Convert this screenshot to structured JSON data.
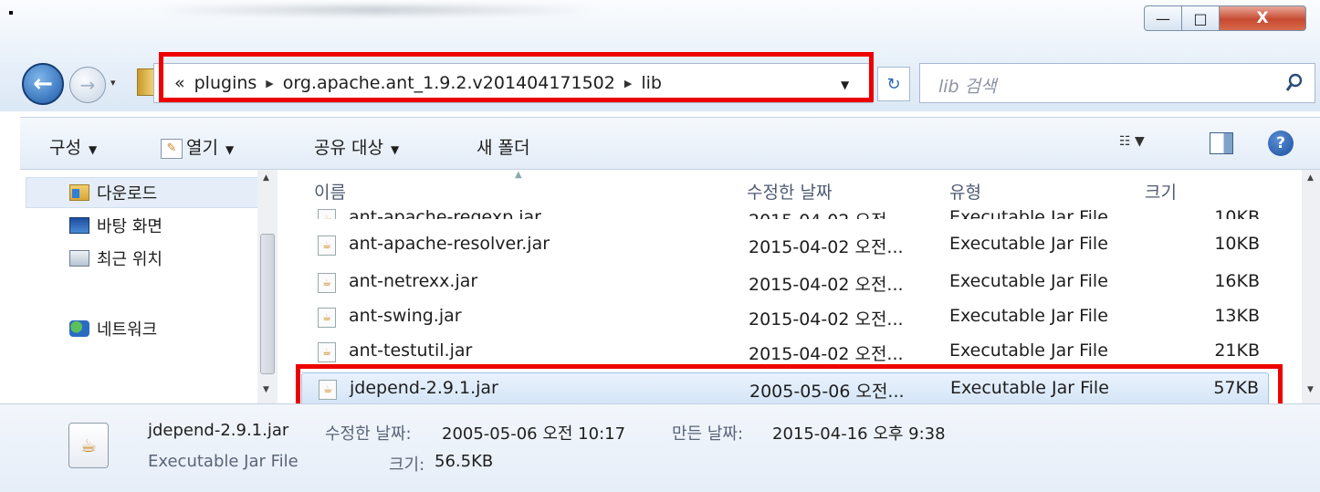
{
  "window": {
    "controls": {
      "minimize": "—",
      "maximize": "□",
      "close": "X"
    }
  },
  "nav": {
    "back_icon": "back-arrow-icon",
    "forward_icon": "forward-arrow-icon",
    "history_dropdown": "▾",
    "address": {
      "overflow": "«",
      "crumbs": [
        "plugins",
        "org.apache.ant_1.9.2.v201404171502",
        "lib"
      ],
      "separator": "▶",
      "dropdown": "▼"
    },
    "refresh_icon": "↻",
    "search": {
      "placeholder": "lib 검색",
      "icon": "magnifier-icon"
    }
  },
  "toolbar": {
    "organize": "구성",
    "open": "열기",
    "share": "공유 대상",
    "new_folder": "새 폴더",
    "dropdown_arrow": "▼",
    "view_icon": "☷",
    "help": "?"
  },
  "nav_pane": {
    "items": [
      {
        "label": "다운로드",
        "icon": "downloads-folder-icon"
      },
      {
        "label": "바탕 화면",
        "icon": "desktop-icon"
      },
      {
        "label": "최근 위치",
        "icon": "recent-places-icon"
      },
      {
        "label": "네트워크",
        "icon": "network-icon"
      }
    ]
  },
  "file_list": {
    "columns": {
      "name": "이름",
      "date": "수정한 날짜",
      "type": "유형",
      "size": "크기"
    },
    "rows": [
      {
        "name": "ant-apache-regexp.jar",
        "date": "2015-04-02 오전...",
        "type": "Executable Jar File",
        "size": "10KB"
      },
      {
        "name": "ant-apache-resolver.jar",
        "date": "2015-04-02 오전...",
        "type": "Executable Jar File",
        "size": "10KB"
      },
      {
        "name": "ant-netrexx.jar",
        "date": "2015-04-02 오전...",
        "type": "Executable Jar File",
        "size": "16KB"
      },
      {
        "name": "ant-swing.jar",
        "date": "2015-04-02 오전...",
        "type": "Executable Jar File",
        "size": "13KB"
      },
      {
        "name": "ant-testutil.jar",
        "date": "2015-04-02 오전...",
        "type": "Executable Jar File",
        "size": "21KB"
      },
      {
        "name": "jdepend-2.9.1.jar",
        "date": "2005-05-06 오전...",
        "type": "Executable Jar File",
        "size": "57KB"
      }
    ]
  },
  "details": {
    "name": "jdepend-2.9.1.jar",
    "modified_label": "수정한 날짜:",
    "modified_value": "2005-05-06 오전 10:17",
    "created_label": "만든 날짜:",
    "created_value": "2015-04-16 오후 9:38",
    "type": "Executable Jar File",
    "size_label": "크기:",
    "size_value": "56.5KB"
  },
  "colors": {
    "highlight": "#e00000",
    "selection": "#d3e4f6"
  }
}
